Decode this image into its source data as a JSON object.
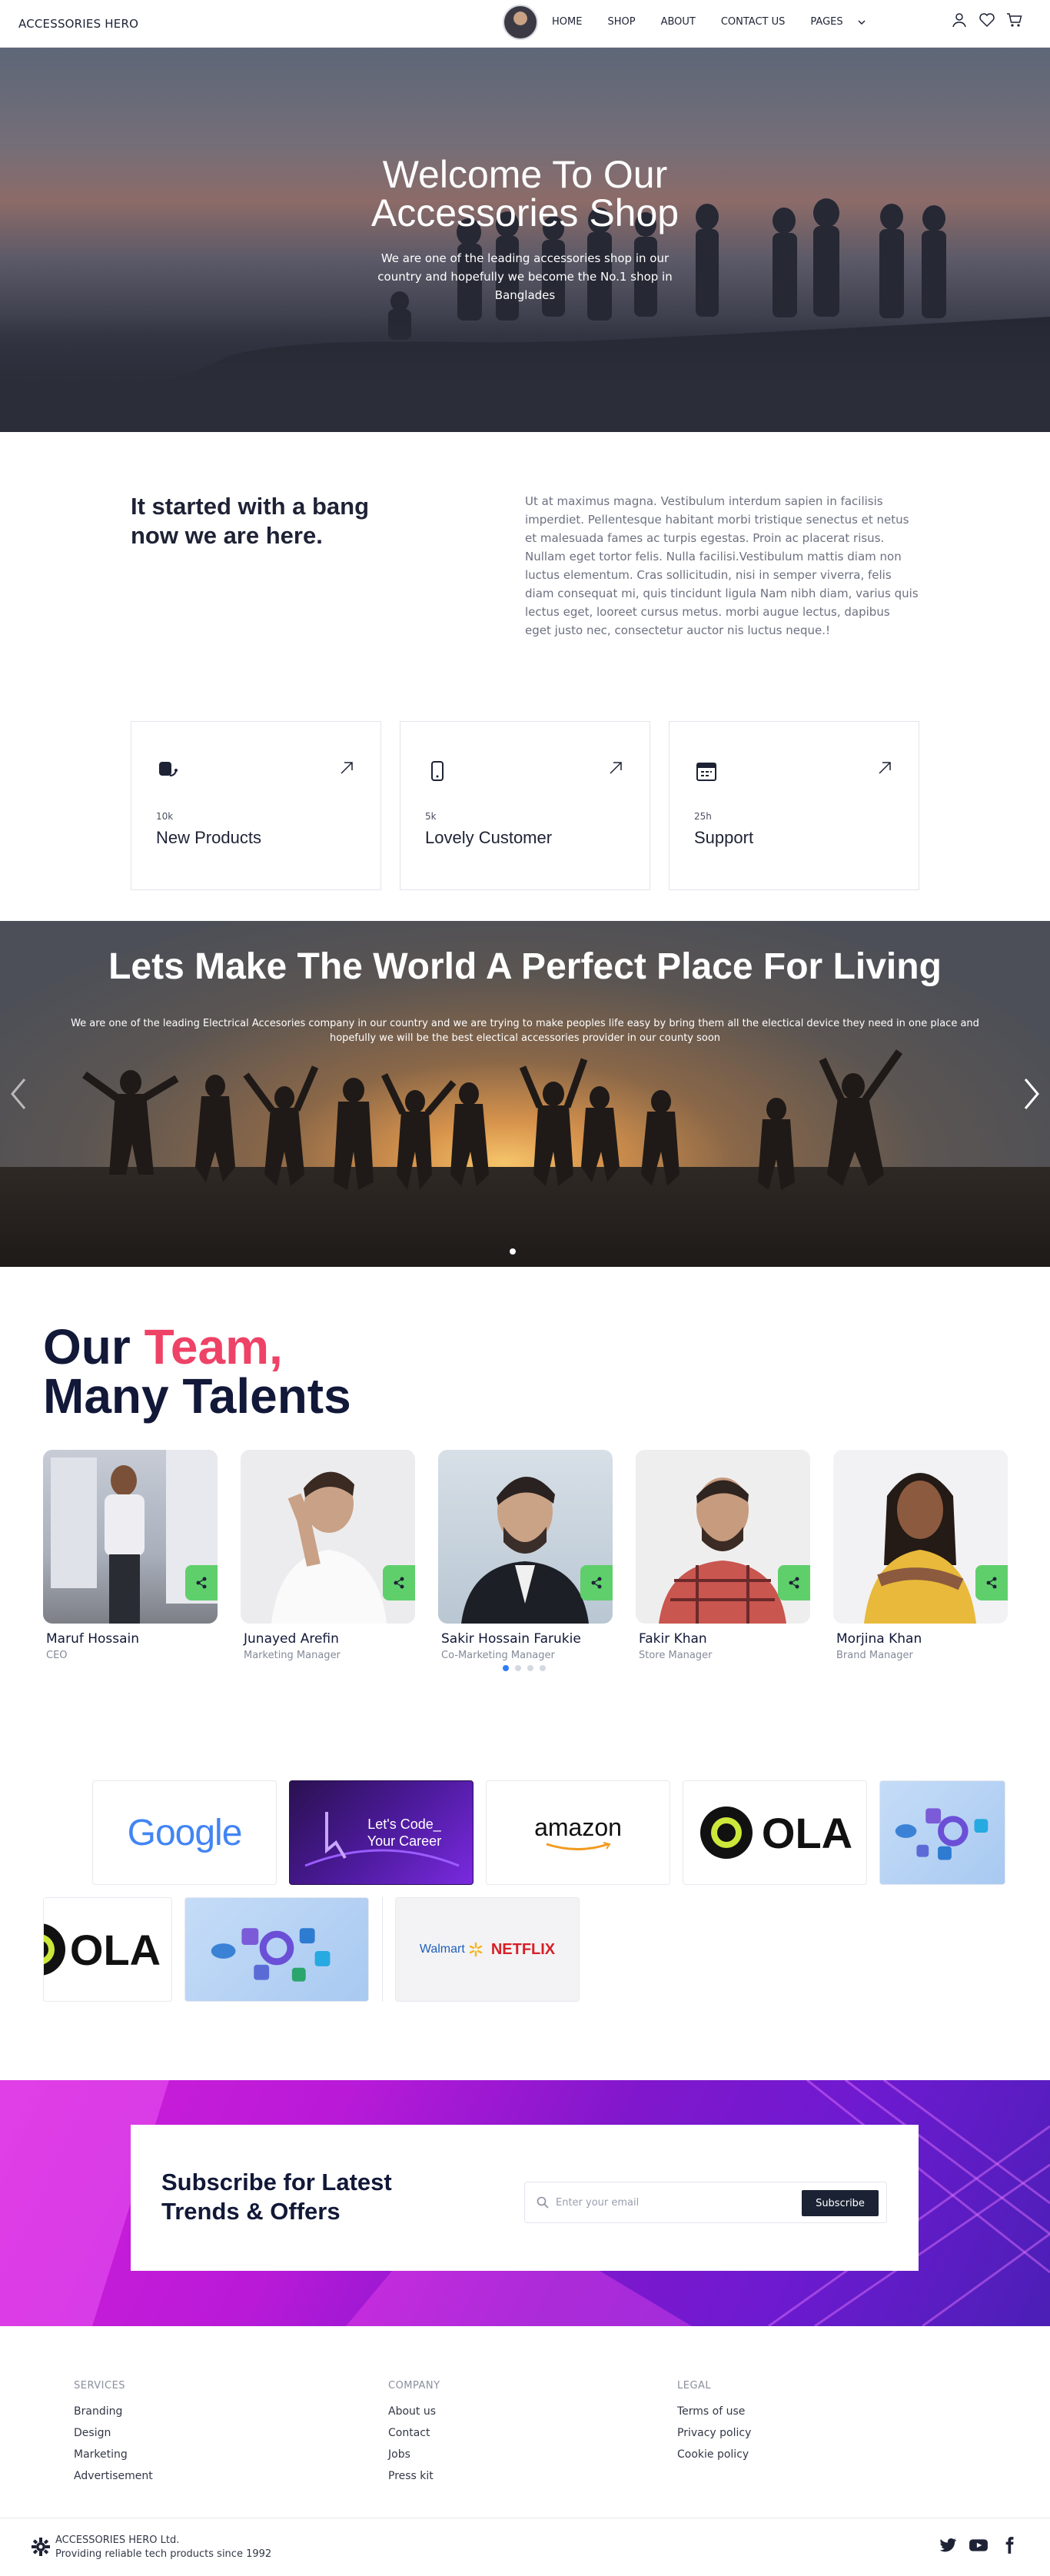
{
  "nav": {
    "brand": "ACCESSORIES HERO",
    "links": [
      "HOME",
      "SHOP",
      "ABOUT",
      "CONTACT US",
      "PAGES"
    ],
    "icons": [
      "user-icon",
      "heart-icon",
      "cart-icon"
    ]
  },
  "hero": {
    "title": "Welcome To Our Accessories Shop",
    "subtitle": "We are one of the leading accessories shop in our country and hopefully we become the No.1 shop in Banglades"
  },
  "about": {
    "title": "It started with a bang now we are here.",
    "text": "Ut at maximus magna. Vestibulum interdum sapien in facilisis imperdiet. Pellentesque habitant morbi tristique senectus et netus et malesuada fames ac turpis egestas. Proin ac placerat risus. Nullam eget tortor felis. Nulla facilisi.Vestibulum mattis diam non luctus elementum. Cras sollicitudin, nisi in semper viverra, felis diam consequat mi, quis tincidunt ligula Nam nibh diam, varius quis lectus eget, looreet cursus metus. morbi augue lectus, dapibus eget justo nec, consectetur auctor nis luctus neque.!",
    "stats": [
      {
        "number": "10k",
        "label": "New Products",
        "icon": "product-icon"
      },
      {
        "number": "5k",
        "label": "Lovely Customer",
        "icon": "phone-icon"
      },
      {
        "number": "25h",
        "label": "Support",
        "icon": "calendar-icon"
      }
    ]
  },
  "slider": {
    "title": "Lets Make The World A Perfect Place For Living",
    "subtitle": "We are one of the leading Electrical Accesories company in our country and we are trying to make peoples life easy by bring them all the electical device they need in one place and hopefully we will be the best electical accessories provider in our county soon"
  },
  "team": {
    "title_part1": "Our ",
    "title_accent": "Team,",
    "title_part2": "Many Talents",
    "members": [
      {
        "name": "Maruf Hossain",
        "role": "CEO"
      },
      {
        "name": "Junayed Arefin",
        "role": "Marketing Manager"
      },
      {
        "name": "Sakir Hossain Farukie",
        "role": "Co-Marketing Manager"
      },
      {
        "name": "Fakir Khan",
        "role": "Store Manager"
      },
      {
        "name": "Morjina Khan",
        "role": "Brand Manager"
      }
    ]
  },
  "partners": {
    "google": "Google",
    "code_line1": "Let's Code_",
    "code_line2": "Your Career",
    "amazon": "amazon",
    "ola": "OLA",
    "walmart": "Walmart",
    "netflix": "NETFLIX"
  },
  "subscribe": {
    "title": "Subscribe for Latest Trends & Offers",
    "placeholder": "Enter your email",
    "button": "Subscribe"
  },
  "footer": {
    "services": {
      "heading": "SERVICES",
      "links": [
        "Branding",
        "Design",
        "Marketing",
        "Advertisement"
      ]
    },
    "company": {
      "heading": "COMPANY",
      "links": [
        "About us",
        "Contact",
        "Jobs",
        "Press kit"
      ]
    },
    "legal": {
      "heading": "LEGAL",
      "links": [
        "Terms of use",
        "Privacy policy",
        "Cookie policy"
      ]
    },
    "brand_line1": "ACCESSORIES HERO Ltd.",
    "brand_line2": "Providing reliable tech products since 1992",
    "socials": [
      "twitter-icon",
      "youtube-icon",
      "facebook-icon"
    ]
  },
  "colors": {
    "accent": "#ee4266",
    "dark": "#111838",
    "share_green": "#5fcf6b",
    "subscribe_button": "#1b2233"
  }
}
